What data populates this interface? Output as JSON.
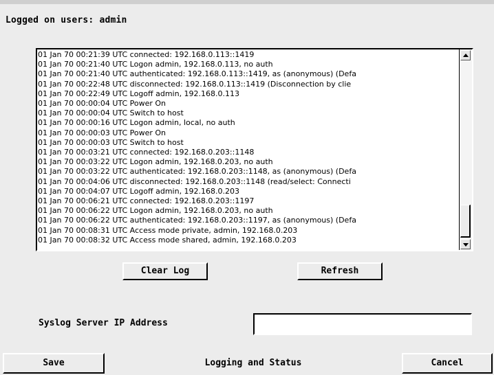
{
  "header": {
    "logged_users": "Logged on users: admin"
  },
  "log": {
    "lines": [
      "01 Jan 70 00:21:39 UTC connected: 192.168.0.113::1419",
      "01 Jan 70 00:21:40 UTC Logon admin, 192.168.0.113, no auth",
      "01 Jan 70 00:21:40 UTC authenticated: 192.168.0.113::1419, as (anonymous) (Defa",
      "01 Jan 70 00:22:48 UTC disconnected: 192.168.0.113::1419 (Disconnection by clie",
      "01 Jan 70 00:22:49 UTC Logoff admin, 192.168.0.113",
      "01 Jan 70 00:00:04 UTC Power On",
      "01 Jan 70 00:00:04 UTC Switch to host",
      "01 Jan 70 00:00:16 UTC Logon admin, local, no auth",
      "01 Jan 70 00:00:03 UTC Power On",
      "01 Jan 70 00:00:03 UTC Switch to host",
      "01 Jan 70 00:03:21 UTC connected: 192.168.0.203::1148",
      "01 Jan 70 00:03:22 UTC Logon admin, 192.168.0.203, no auth",
      "01 Jan 70 00:03:22 UTC authenticated: 192.168.0.203::1148, as (anonymous) (Defa",
      "01 Jan 70 00:04:06 UTC disconnected: 192.168.0.203::1148 (read/select: Connecti",
      "01 Jan 70 00:04:07 UTC Logoff admin, 192.168.0.203",
      "01 Jan 70 00:06:21 UTC connected: 192.168.0.203::1197",
      "01 Jan 70 00:06:22 UTC Logon admin, 192.168.0.203, no auth",
      "01 Jan 70 00:06:22 UTC authenticated: 192.168.0.203::1197, as (anonymous) (Defa",
      "01 Jan 70 00:08:31 UTC Access mode private, admin, 192.168.0.203",
      "01 Jan 70 00:08:32 UTC Access mode shared, admin, 192.168.0.203"
    ],
    "scroll_position": 1.0
  },
  "buttons": {
    "clear_log": "Clear Log",
    "refresh": "Refresh",
    "save": "Save",
    "cancel": "Cancel"
  },
  "syslog": {
    "label": "Syslog Server IP Address",
    "value": ""
  },
  "status": {
    "title": "Logging and Status"
  }
}
